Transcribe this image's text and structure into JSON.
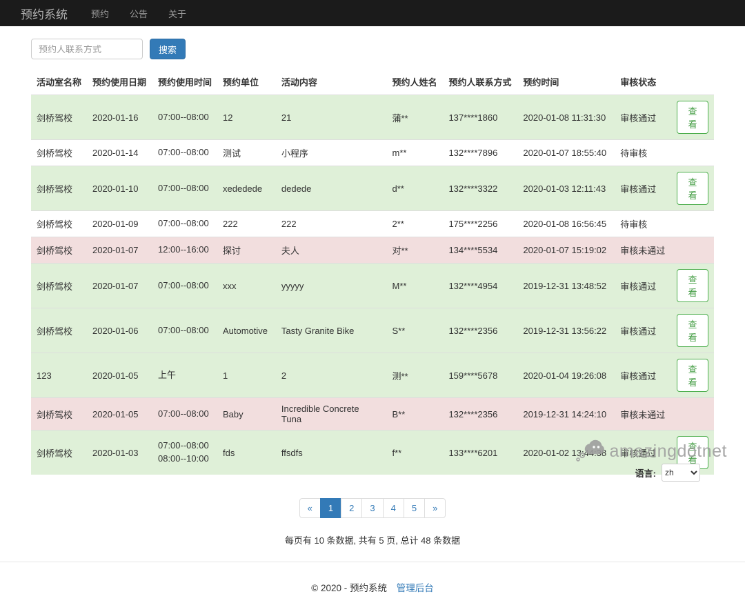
{
  "navbar": {
    "brand": "预约系统",
    "items": [
      {
        "label": "预约"
      },
      {
        "label": "公告"
      },
      {
        "label": "关于"
      }
    ]
  },
  "search": {
    "placeholder": "预约人联系方式",
    "button_label": "搜索"
  },
  "table": {
    "headers": [
      "活动室名称",
      "预约使用日期",
      "预约使用时间",
      "预约单位",
      "活动内容",
      "预约人姓名",
      "预约人联系方式",
      "预约时间",
      "审核状态",
      ""
    ],
    "view_label": "查看",
    "rows": [
      {
        "room": "剑桥驾校",
        "date": "2020-01-16",
        "time": "07:00--08:00",
        "unit": "12",
        "content": "21",
        "name": "蒲**",
        "contact": "137****1860",
        "booked_at": "2020-01-08 11:31:30",
        "status": "审核通过",
        "status_type": "success",
        "has_view": true
      },
      {
        "room": "剑桥驾校",
        "date": "2020-01-14",
        "time": "07:00--08:00",
        "unit": "测试",
        "content": "小程序",
        "name": "m**",
        "contact": "132****7896",
        "booked_at": "2020-01-07 18:55:40",
        "status": "待审核",
        "status_type": "default",
        "has_view": false
      },
      {
        "room": "剑桥驾校",
        "date": "2020-01-10",
        "time": "07:00--08:00",
        "unit": "xededede",
        "content": "dedede",
        "name": "d**",
        "contact": "132****3322",
        "booked_at": "2020-01-03 12:11:43",
        "status": "审核通过",
        "status_type": "success",
        "has_view": true
      },
      {
        "room": "剑桥驾校",
        "date": "2020-01-09",
        "time": "07:00--08:00",
        "unit": "222",
        "content": "222",
        "name": "2**",
        "contact": "175****2256",
        "booked_at": "2020-01-08 16:56:45",
        "status": "待审核",
        "status_type": "default",
        "has_view": false
      },
      {
        "room": "剑桥驾校",
        "date": "2020-01-07",
        "time": "12:00--16:00",
        "unit": "探讨",
        "content": "夫人",
        "name": "对**",
        "contact": "134****5534",
        "booked_at": "2020-01-07 15:19:02",
        "status": "审核未通过",
        "status_type": "danger",
        "has_view": false
      },
      {
        "room": "剑桥驾校",
        "date": "2020-01-07",
        "time": "07:00--08:00",
        "unit": "xxx",
        "content": "yyyyy",
        "name": "M**",
        "contact": "132****4954",
        "booked_at": "2019-12-31 13:48:52",
        "status": "审核通过",
        "status_type": "success",
        "has_view": true
      },
      {
        "room": "剑桥驾校",
        "date": "2020-01-06",
        "time": "07:00--08:00",
        "unit": "Automotive",
        "content": "Tasty Granite Bike",
        "name": "S**",
        "contact": "132****2356",
        "booked_at": "2019-12-31 13:56:22",
        "status": "审核通过",
        "status_type": "success",
        "has_view": true
      },
      {
        "room": "123",
        "date": "2020-01-05",
        "time": "上午",
        "unit": "1",
        "content": "2",
        "name": "测**",
        "contact": "159****5678",
        "booked_at": "2020-01-04 19:26:08",
        "status": "审核通过",
        "status_type": "success",
        "has_view": true
      },
      {
        "room": "剑桥驾校",
        "date": "2020-01-05",
        "time": "07:00--08:00",
        "unit": "Baby",
        "content": "Incredible Concrete Tuna",
        "name": "B**",
        "contact": "132****2356",
        "booked_at": "2019-12-31 14:24:10",
        "status": "审核未通过",
        "status_type": "danger",
        "has_view": false
      },
      {
        "room": "剑桥驾校",
        "date": "2020-01-03",
        "time": "07:00--08:00\n08:00--10:00",
        "unit": "fds",
        "content": "ffsdfs",
        "name": "f**",
        "contact": "133****6201",
        "booked_at": "2020-01-02 13:44:38",
        "status": "审核通过",
        "status_type": "success",
        "has_view": true
      }
    ]
  },
  "pagination": {
    "prev": "«",
    "next": "»",
    "pages": [
      "1",
      "2",
      "3",
      "4",
      "5"
    ],
    "active": "1"
  },
  "summary": "每页有 10 条数据, 共有 5 页, 总计 48 条数据",
  "footer": {
    "copyright": "© 2020 - 预约系统",
    "admin_link": "管理后台",
    "language_label": "语言:",
    "language_value": "zh"
  },
  "watermark": {
    "text": "amazingdotnet"
  },
  "colors": {
    "accent_blue": "#337ab7",
    "success_row": "#dff0d8",
    "danger_row": "#f2dede",
    "navbar_bg": "#1b1b1b",
    "view_green": "#449d44"
  }
}
